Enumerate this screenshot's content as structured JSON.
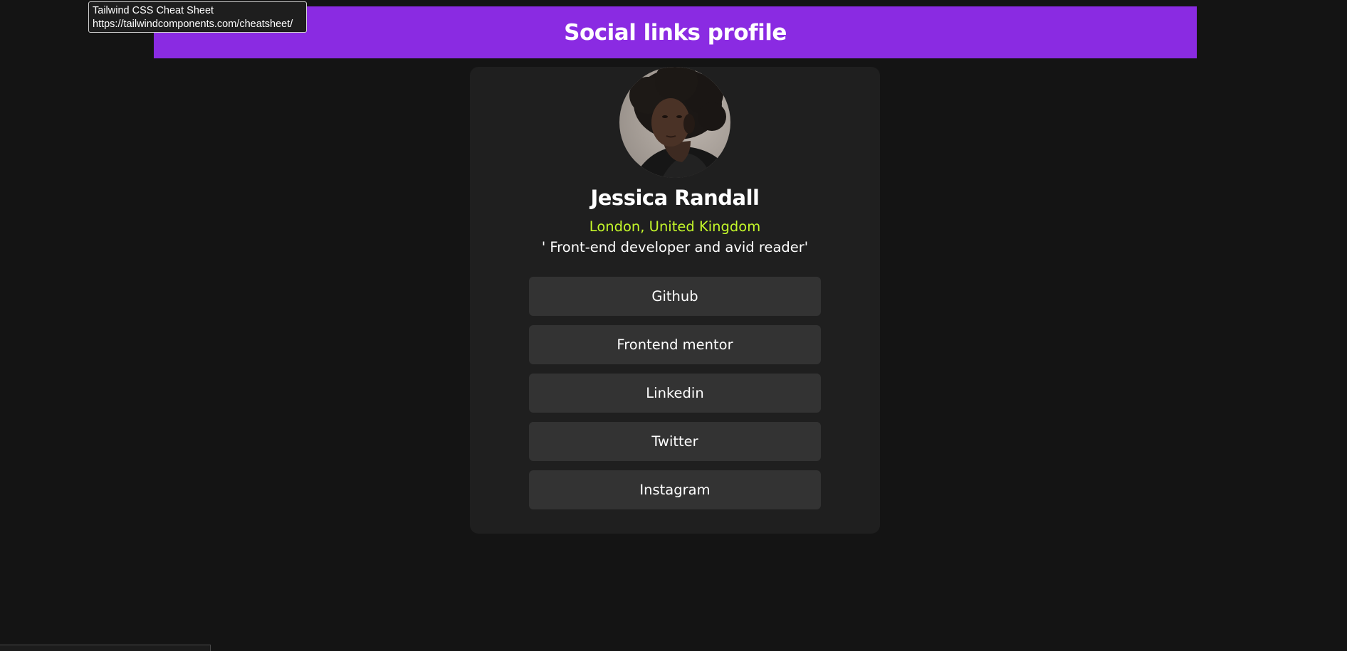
{
  "tooltip": {
    "title": "Tailwind CSS Cheat Sheet",
    "url": "https://tailwindcomponents.com/cheatsheet/"
  },
  "banner": {
    "title": "Social links profile"
  },
  "profile": {
    "name": "Jessica Randall",
    "location": "London, United Kingdom",
    "bio": "' Front-end developer and avid reader'",
    "avatar_icon": "profile-photo"
  },
  "links": [
    {
      "label": "Github"
    },
    {
      "label": "Frontend mentor"
    },
    {
      "label": "Linkedin"
    },
    {
      "label": "Twitter"
    },
    {
      "label": "Instagram"
    }
  ],
  "colors": {
    "background": "#141414",
    "banner": "#8a2be2",
    "card": "#1f1f1f",
    "button": "#333333",
    "location": "#c4f82a",
    "text": "#ffffff"
  }
}
